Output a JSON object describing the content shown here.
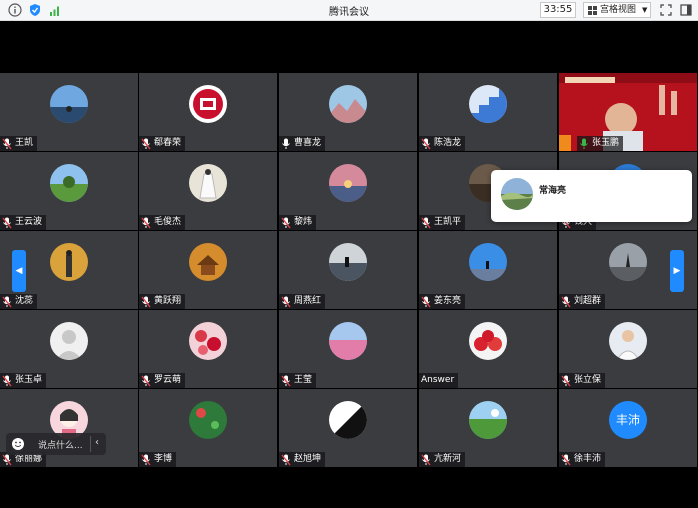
{
  "window": {
    "title": "腾讯会议",
    "timer": "33:55",
    "view_label": "宫格视图"
  },
  "popup": {
    "name": "常海亮"
  },
  "chat": {
    "placeholder": "说点什么..."
  },
  "tiles": [
    {
      "name": "王凯",
      "mic": "muted",
      "avatar": "photo-beach"
    },
    {
      "name": "郗春荣",
      "mic": "muted",
      "avatar": "logo-red"
    },
    {
      "name": "曹喜龙",
      "mic": "on",
      "avatar": "photo-mountain"
    },
    {
      "name": "陈浩龙",
      "mic": "muted",
      "avatar": "photo-stairs"
    },
    {
      "name": "张玉鹏",
      "mic": "on",
      "avatar": "video"
    },
    {
      "name": "王云波",
      "mic": "muted",
      "avatar": "photo-field"
    },
    {
      "name": "毛俊杰",
      "mic": "muted",
      "avatar": "photo-dress"
    },
    {
      "name": "黎炜",
      "mic": "muted",
      "avatar": "photo-sunset"
    },
    {
      "name": "王凯平",
      "mic": "muted",
      "avatar": "photo-dark"
    },
    {
      "name": "钱大",
      "mic": "muted",
      "avatar": "photo-blue"
    },
    {
      "name": "沈蕊",
      "mic": "muted",
      "avatar": "photo-autumn"
    },
    {
      "name": "黄跃翔",
      "mic": "muted",
      "avatar": "photo-temple"
    },
    {
      "name": "周燕红",
      "mic": "muted",
      "avatar": "photo-lake"
    },
    {
      "name": "姜东亮",
      "mic": "muted",
      "avatar": "photo-sky"
    },
    {
      "name": "刘超群",
      "mic": "muted",
      "avatar": "photo-dance"
    },
    {
      "name": "张玉卓",
      "mic": "muted",
      "avatar": "default"
    },
    {
      "name": "罗云萌",
      "mic": "muted",
      "avatar": "photo-hearts"
    },
    {
      "name": "王莹",
      "mic": "muted",
      "avatar": "photo-flowers"
    },
    {
      "name": "Answer",
      "mic": "none",
      "avatar": "photo-strawberry"
    },
    {
      "name": "张立保",
      "mic": "muted",
      "avatar": "photo-office"
    },
    {
      "name": "徐丽娜",
      "mic": "muted",
      "avatar": "cartoon-girl"
    },
    {
      "name": "李博",
      "mic": "muted",
      "avatar": "photo-green"
    },
    {
      "name": "赵旭坤",
      "mic": "muted",
      "avatar": "photo-bw"
    },
    {
      "name": "亢新河",
      "mic": "muted",
      "avatar": "photo-meadow"
    },
    {
      "name": "徐丰沛",
      "mic": "muted",
      "avatar": "text",
      "avatar_text": "丰沛"
    }
  ],
  "colors": {
    "accent": "#1f8bff",
    "tile": "#3a3c40",
    "muted_red": "#e0444a",
    "mic_green": "#3bb54a"
  }
}
